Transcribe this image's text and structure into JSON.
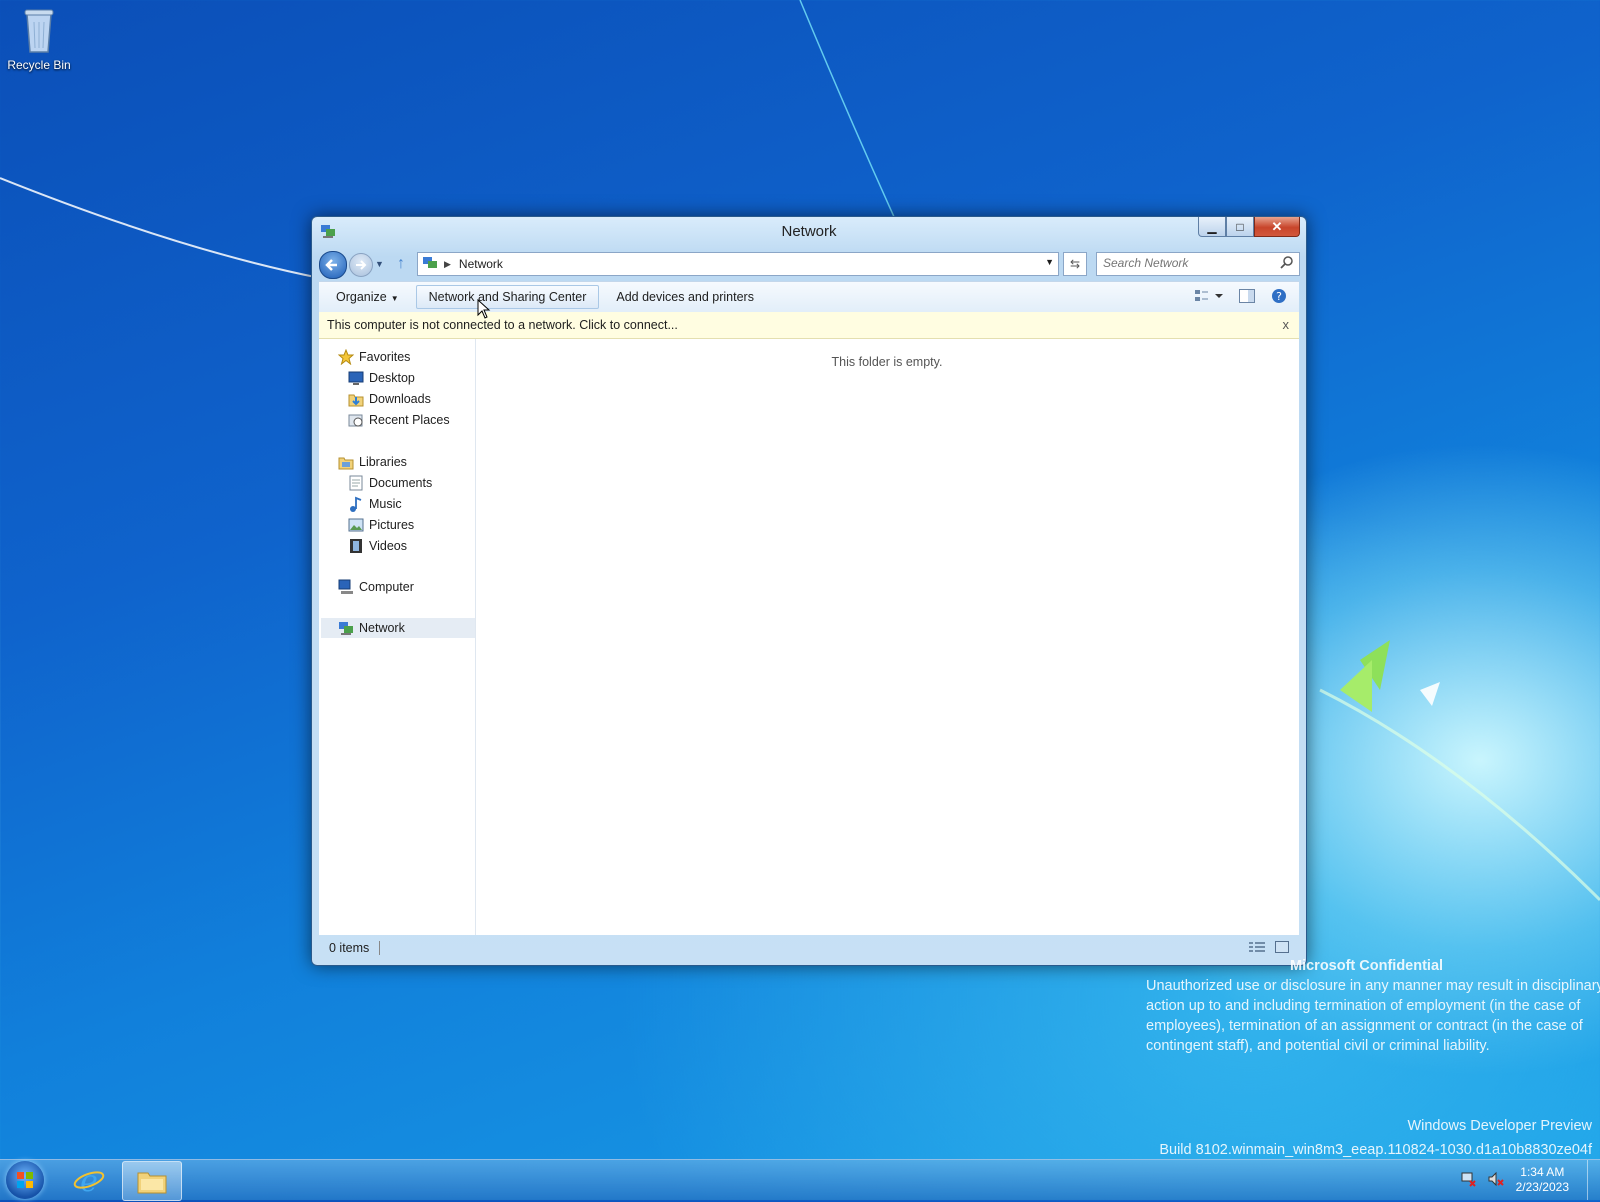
{
  "desktop": {
    "recycle_bin_label": "Recycle Bin",
    "watermark": {
      "title": "Microsoft Confidential",
      "body": "Unauthorized use or disclosure in any manner may result in disciplinary action up to and including termination of employment (in the case of employees), termination of an assignment or contract (in the case of contingent staff), and potential civil or criminal liability.",
      "edition": "Windows Developer Preview",
      "build": "Build 8102.winmain_win8m3_eeap.110824-1030.d1a10b8830ze04f"
    }
  },
  "window": {
    "title": "Network",
    "address": {
      "crumb": "Network"
    },
    "search": {
      "placeholder": "Search Network"
    },
    "toolbar": {
      "organize": "Organize",
      "network_sharing": "Network and Sharing Center",
      "add_devices": "Add devices and printers"
    },
    "infobar": {
      "message": "This computer is not connected to a network. Click to connect...",
      "close": "x"
    },
    "nav": {
      "favorites": "Favorites",
      "desktop": "Desktop",
      "downloads": "Downloads",
      "recent_places": "Recent Places",
      "libraries": "Libraries",
      "documents": "Documents",
      "music": "Music",
      "pictures": "Pictures",
      "videos": "Videos",
      "computer": "Computer",
      "network": "Network"
    },
    "empty_message": "This folder is empty.",
    "status": {
      "items": "0 items"
    }
  },
  "taskbar": {
    "time": "1:34 AM",
    "date": "2/23/2023"
  },
  "colors": {
    "accent": "#1d5db6",
    "infobar_bg": "#fffde1",
    "desktop_blue": "#0f63cc"
  }
}
